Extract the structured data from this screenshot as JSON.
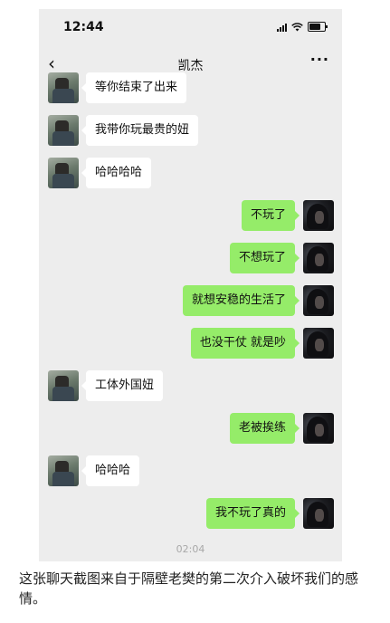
{
  "status_bar": {
    "time": "12:44"
  },
  "nav": {
    "title": "凯杰",
    "more": "···",
    "back": "‹"
  },
  "messages": [
    {
      "side": "left",
      "text": "等你结束了出来"
    },
    {
      "side": "left",
      "text": "我带你玩最贵的妞"
    },
    {
      "side": "left",
      "text": "哈哈哈哈"
    },
    {
      "side": "right",
      "text": "不玩了"
    },
    {
      "side": "right",
      "text": "不想玩了"
    },
    {
      "side": "right",
      "text": "就想安稳的生活了"
    },
    {
      "side": "right",
      "text": "也没干仗 就是吵"
    },
    {
      "side": "left",
      "text": "工体外国妞"
    },
    {
      "side": "right",
      "text": "老被挨练"
    },
    {
      "side": "left",
      "text": "哈哈哈"
    },
    {
      "side": "right",
      "text": "我不玩了真的"
    }
  ],
  "timestamp": "02:04",
  "caption": "这张聊天截图来自于隔壁老樊的第二次介入破坏我们的感情。",
  "colors": {
    "chat_bg": "#ededed",
    "right_bubble": "#95ec69",
    "left_bubble": "#ffffff"
  }
}
